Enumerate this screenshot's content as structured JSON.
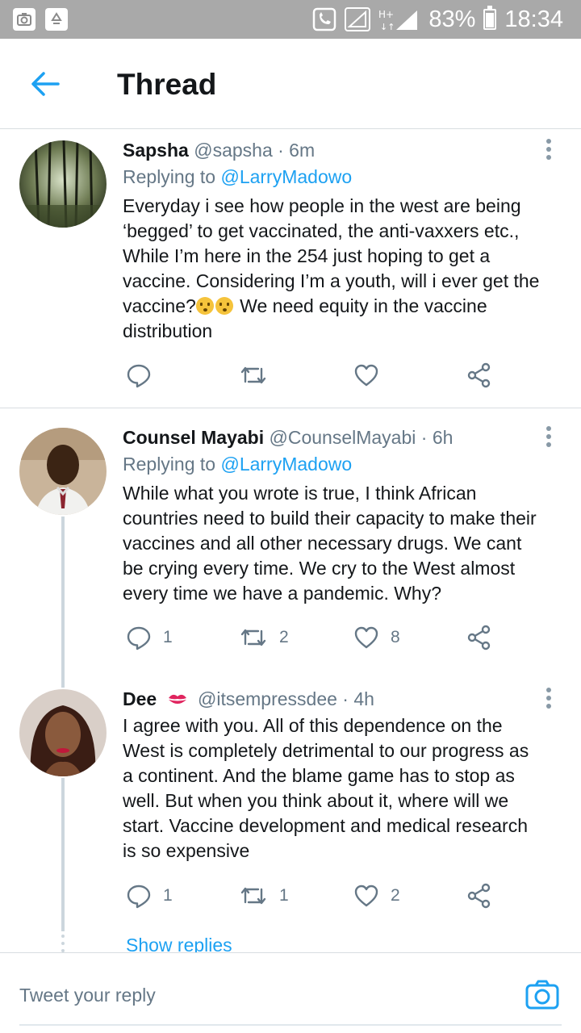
{
  "status_bar": {
    "battery": "83%",
    "time": "18:34",
    "battery_level": 0.83
  },
  "header": {
    "title": "Thread"
  },
  "tweets": [
    {
      "name": "Sapsha",
      "handle": "@sapsha",
      "time": "· 6m",
      "replying_label": "Replying to",
      "replying_to": "@LarryMadowo",
      "text_lines": [
        "Everyday i see how people in the west are being",
        "‘begged’ to get vaccinated, the anti-vaxxers etc.,",
        "While I’m here in the 254 just hoping to get a",
        "vaccine. Considering I’m a youth, will i ever get the",
        "vaccine?",
        " We need equity in the vaccine",
        "distribution"
      ],
      "replies": "",
      "retweets": "",
      "likes": ""
    },
    {
      "name": "Counsel Mayabi",
      "handle": "@CounselMayabi",
      "time": "· 6h",
      "replying_label": "Replying to",
      "replying_to": "@LarryMadowo",
      "text_lines": [
        "While what you wrote is true, I think African",
        "countries need to build their capacity to make their",
        "vaccines and all other necessary drugs. We cant",
        "be crying every time. We cry to the West almost",
        "every time  we have a pandemic. Why?"
      ],
      "replies": "1",
      "retweets": "2",
      "likes": "8"
    },
    {
      "name": "Dee",
      "handle": "@itsempressdee",
      "time": "· 4h",
      "text_lines": [
        "I agree with you. All of this dependence on the",
        "West is completely detrimental to our progress as",
        "a continent. And the blame game has to stop as",
        "well. But when you think about it, where will we",
        "start. Vaccine development and medical research",
        "is so expensive"
      ],
      "replies": "1",
      "retweets": "1",
      "likes": "2"
    }
  ],
  "show_replies": "Show replies",
  "reply_bar": {
    "placeholder": "Tweet your reply"
  },
  "colors": {
    "accent": "#1da1f2",
    "status_bar": "#a9a9a9",
    "muted": "#657786"
  }
}
